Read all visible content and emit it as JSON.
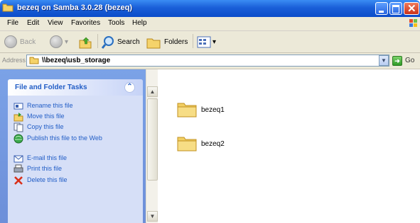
{
  "window": {
    "title": "bezeq on Samba 3.0.28 (bezeq)"
  },
  "menu": {
    "items": [
      "File",
      "Edit",
      "View",
      "Favorites",
      "Tools",
      "Help"
    ]
  },
  "toolbar": {
    "back_label": "Back",
    "search_label": "Search",
    "folders_label": "Folders"
  },
  "address": {
    "label": "Address",
    "value": "\\\\bezeq\\usb_storage",
    "go_label": "Go"
  },
  "tasks": {
    "title": "File and Folder Tasks",
    "items": [
      "Rename this file",
      "Move this file",
      "Copy this file",
      "Publish this file to the Web",
      "E-mail this file",
      "Print this file",
      "Delete this file"
    ]
  },
  "files": [
    {
      "name": "bezeq1",
      "icon": "folder-icon"
    },
    {
      "name": "bezeq2",
      "icon": "folder-icon"
    }
  ],
  "colors": {
    "titlebar": "#0b4cc9",
    "task_text": "#215dc6",
    "pane": "#7ba2e7"
  }
}
